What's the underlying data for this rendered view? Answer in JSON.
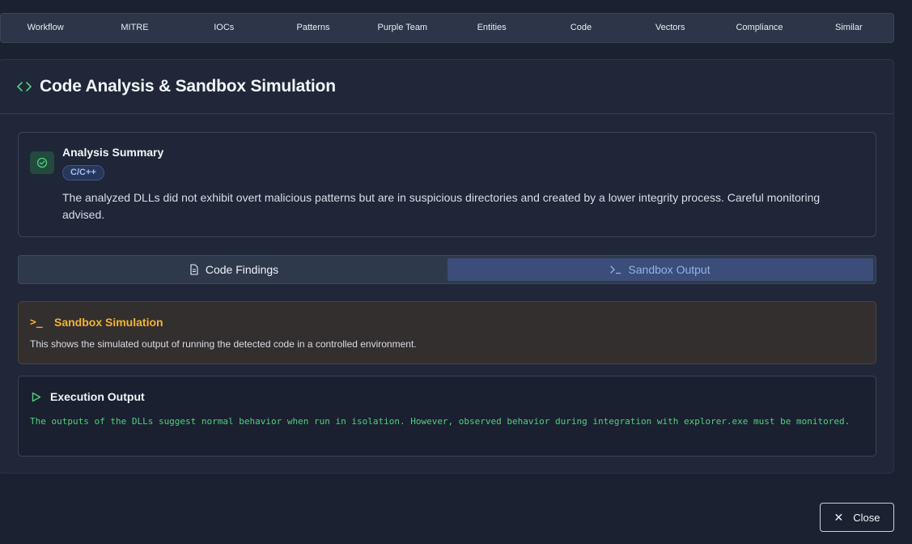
{
  "nav_tabs": [
    "Workflow",
    "MITRE",
    "IOCs",
    "Patterns",
    "Purple Team",
    "Entities",
    "Code",
    "Vectors",
    "Compliance",
    "Similar"
  ],
  "panel": {
    "title": "Code Analysis & Sandbox Simulation",
    "icon": "code-brackets-icon"
  },
  "summary": {
    "title": "Analysis Summary",
    "language": "C/C++",
    "text": "The analyzed DLLs did not exhibit overt malicious patterns but are in suspicious directories and created by a lower integrity process. Careful monitoring advised.",
    "icon": "check-circle-icon"
  },
  "subtabs": {
    "code_findings": "Code Findings",
    "sandbox_output": "Sandbox Output",
    "active": "sandbox_output"
  },
  "sandbox": {
    "icon_glyph": ">_",
    "title": "Sandbox Simulation",
    "description": "This shows the simulated output of running the detected code in a controlled environment."
  },
  "execution": {
    "title": "Execution Output",
    "output": "The outputs of the DLLs suggest normal behavior when run in isolation. However, observed behavior during integration with explorer.exe must be monitored."
  },
  "close_label": "Close",
  "colors": {
    "background": "#1a2130",
    "accent_green": "#4fd17d",
    "accent_amber": "#f2b531",
    "accent_blue": "#8fb3f0"
  }
}
